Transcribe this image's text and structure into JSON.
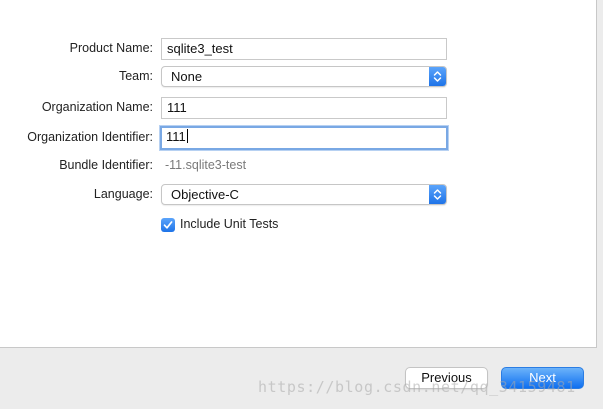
{
  "form": {
    "product_name": {
      "label": "Product Name:",
      "value": "sqlite3_test"
    },
    "team": {
      "label": "Team:",
      "value": "None"
    },
    "organization_name": {
      "label": "Organization Name:",
      "value": "111"
    },
    "organization_identifier": {
      "label": "Organization Identifier:",
      "value": "111"
    },
    "bundle_identifier": {
      "label": "Bundle Identifier:",
      "value": "-11.sqlite3-test"
    },
    "language": {
      "label": "Language:",
      "value": "Objective-C"
    },
    "include_unit_tests": {
      "label": "Include Unit Tests",
      "checked": true
    }
  },
  "buttons": {
    "previous_label": "Previous",
    "next_label": "Next"
  },
  "watermark": "https://blog.csdn.net/qq_34159481",
  "colors": {
    "accent": "#1e73e8",
    "focus_ring": "#79a8e4"
  }
}
